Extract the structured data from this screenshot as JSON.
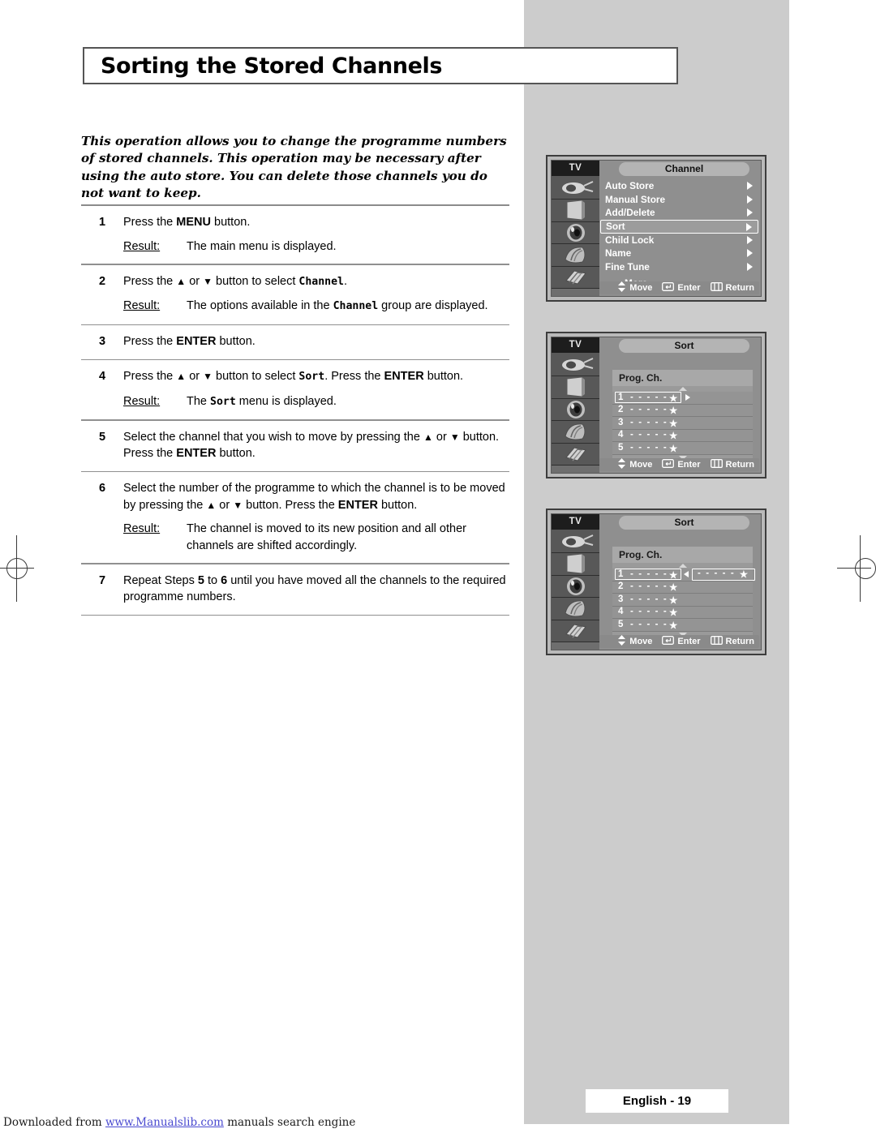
{
  "page": {
    "title": "Sorting the Stored Channels",
    "intro": "This operation allows you to change the programme numbers of stored channels. This operation may be necessary after using the auto store. You can delete those channels you do not want to keep.",
    "page_label": "English - 19"
  },
  "attribution": {
    "prefix": "Downloaded from ",
    "link": "www.Manualslib.com",
    "suffix": " manuals search engine"
  },
  "steps": [
    {
      "num": "1",
      "instruction_html": "Press the <b class=\"k\">MENU</b> button.",
      "result_label": "Result:",
      "result_html": "The main menu is displayed."
    },
    {
      "num": "2",
      "instruction_html": "Press the <span class=\"arrowg\">▲</span> or <span class=\"arrowg\">▼</span> button to select <span class=\"mono\">Channel</span>.",
      "result_label": "Result:",
      "result_html": "The options available in the <span class=\"mono\">Channel</span> group are displayed."
    },
    {
      "num": "3",
      "instruction_html": "Press the <b class=\"k\">ENTER</b> button.",
      "result_label": "",
      "result_html": ""
    },
    {
      "num": "4",
      "instruction_html": "Press the <span class=\"arrowg\">▲</span> or <span class=\"arrowg\">▼</span> button to select <span class=\"mono\">Sort</span>. Press the <b class=\"k\">ENTER</b> button.",
      "result_label": "Result:",
      "result_html": "The <span class=\"mono\">Sort</span> menu is displayed."
    },
    {
      "num": "5",
      "instruction_html": "Select the channel that you wish to move by pressing the <span class=\"arrowg\">▲</span> or <span class=\"arrowg\">▼</span> button. Press the <b class=\"k\">ENTER</b> button.",
      "result_label": "",
      "result_html": ""
    },
    {
      "num": "6",
      "instruction_html": "Select the number of the programme to which the channel is to be moved by pressing the <span class=\"arrowg\">▲</span> or <span class=\"arrowg\">▼</span> button. Press the <b class=\"k\">ENTER</b> button.",
      "result_label": "Result:",
      "result_html": "The channel is moved to its new position and all other channels are shifted accordingly."
    },
    {
      "num": "7",
      "instruction_html": "Repeat Steps <b class=\"k\">5</b> to <b class=\"k\">6</b> until you have moved all the channels to the required programme numbers.",
      "result_label": "",
      "result_html": ""
    }
  ],
  "osd_common": {
    "source_tag": "TV",
    "sidebar_icons": [
      "antenna-icon",
      "tv-set-icon",
      "speaker-icon",
      "setup-icon",
      "input-icon"
    ],
    "footer": [
      {
        "icon": "up-down-arrows-icon",
        "label": "Move"
      },
      {
        "icon": "enter-key-icon",
        "label": "Enter"
      },
      {
        "icon": "return-key-icon",
        "label": "Return"
      }
    ]
  },
  "osd_channel": {
    "title": "Channel",
    "items": [
      {
        "label": "Auto Store",
        "selected": false
      },
      {
        "label": "Manual Store",
        "selected": false
      },
      {
        "label": "Add/Delete",
        "selected": false
      },
      {
        "label": "Sort",
        "selected": true
      },
      {
        "label": "Child Lock",
        "selected": false
      },
      {
        "label": "Name",
        "selected": false
      },
      {
        "label": "Fine Tune",
        "selected": false
      }
    ],
    "more_label": "More"
  },
  "osd_sort_a": {
    "title": "Sort",
    "column_header": "Prog.  Ch.",
    "rows": [
      {
        "prog": "1",
        "ch": "- - - - -",
        "star": "★",
        "highlighted": true
      },
      {
        "prog": "2",
        "ch": "- - - - -",
        "star": "★",
        "highlighted": false
      },
      {
        "prog": "3",
        "ch": "- - - - -",
        "star": "★",
        "highlighted": false
      },
      {
        "prog": "4",
        "ch": "- - - - -",
        "star": "★",
        "highlighted": false
      },
      {
        "prog": "5",
        "ch": "- - - - -",
        "star": "★",
        "highlighted": false
      }
    ]
  },
  "osd_sort_b": {
    "title": "Sort",
    "column_header": "Prog.  Ch.",
    "rows": [
      {
        "prog": "1",
        "ch": "- - - - -",
        "star": "★",
        "highlighted": true
      },
      {
        "prog": "2",
        "ch": "- - - - -",
        "star": "★",
        "highlighted": false
      },
      {
        "prog": "3",
        "ch": "- - - - -",
        "star": "★",
        "highlighted": false
      },
      {
        "prog": "4",
        "ch": "- - - - -",
        "star": "★",
        "highlighted": false
      },
      {
        "prog": "5",
        "ch": "- - - - -",
        "star": "★",
        "highlighted": false
      }
    ],
    "destination": {
      "ch": "- - - - -",
      "star": "★"
    }
  }
}
